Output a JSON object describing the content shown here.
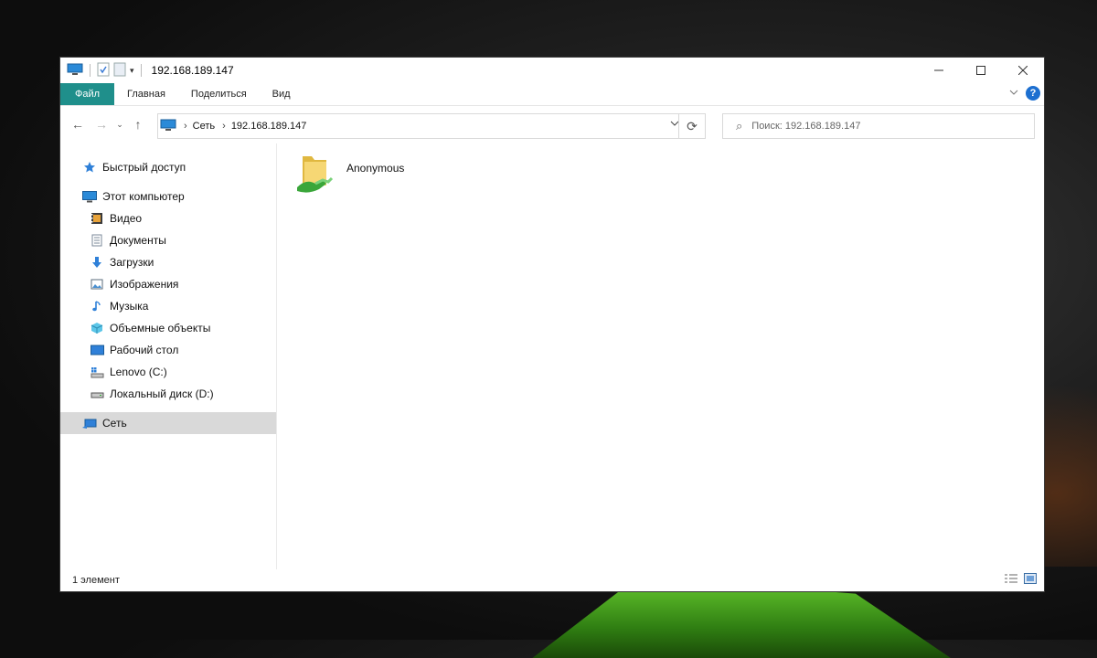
{
  "window": {
    "title": "192.168.189.147"
  },
  "ribbon": {
    "tabs": [
      "Файл",
      "Главная",
      "Поделиться",
      "Вид"
    ],
    "help_label": "?"
  },
  "navigation": {
    "breadcrumbs": [
      "Сеть",
      "192.168.189.147"
    ],
    "search_placeholder": "Поиск: 192.168.189.147"
  },
  "sidebar": {
    "quick_access": "Быстрый доступ",
    "this_pc": "Этот компьютер",
    "pc_items": [
      {
        "label": "Видео",
        "icon": "video-folder-icon"
      },
      {
        "label": "Документы",
        "icon": "documents-folder-icon"
      },
      {
        "label": "Загрузки",
        "icon": "downloads-arrow-icon"
      },
      {
        "label": "Изображения",
        "icon": "pictures-folder-icon"
      },
      {
        "label": "Музыка",
        "icon": "music-note-icon"
      },
      {
        "label": "Объемные объекты",
        "icon": "3d-objects-icon"
      },
      {
        "label": "Рабочий стол",
        "icon": "desktop-icon"
      },
      {
        "label": "Lenovo (C:)",
        "icon": "windows-drive-icon"
      },
      {
        "label": "Локальный диск (D:)",
        "icon": "local-drive-icon"
      }
    ],
    "network": "Сеть"
  },
  "content": {
    "items": [
      {
        "name": "Anonymous",
        "icon": "shared-folder-icon"
      }
    ]
  },
  "status": {
    "count": "1 элемент"
  },
  "colors": {
    "file_tab": "#1f8f8b",
    "selection": "#d9d9d9",
    "help": "#1c6fd0"
  }
}
